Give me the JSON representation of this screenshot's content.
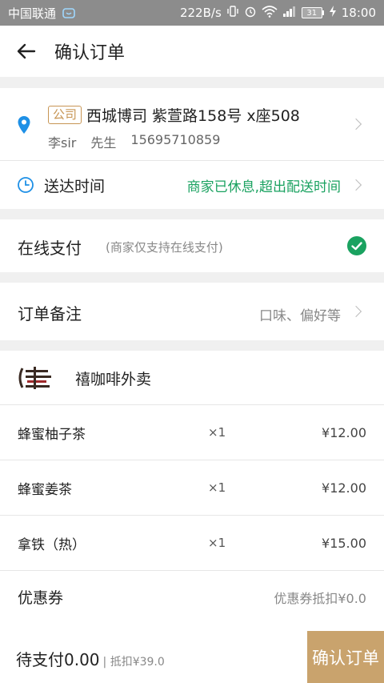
{
  "status_bar": {
    "carrier": "中国联通",
    "speed": "222B/s",
    "battery": "31",
    "time": "18:00"
  },
  "header": {
    "title": "确认订单"
  },
  "address": {
    "tag": "公司",
    "line": "西城博司 紫萱路158号  x座508",
    "name": "李sir",
    "title": "先生",
    "phone": "15695710859"
  },
  "delivery": {
    "label": "送达时间",
    "status": "商家已休息,超出配送时间"
  },
  "payment": {
    "label": "在线支付",
    "note": "(商家仅支持在线支付)"
  },
  "remark": {
    "label": "订单备注",
    "placeholder": "口味、偏好等"
  },
  "shop": {
    "name": "禧咖啡外卖"
  },
  "items": [
    {
      "name": "蜂蜜柚子茶",
      "qty": "×1",
      "price": "¥12.00"
    },
    {
      "name": "蜂蜜姜茶",
      "qty": "×1",
      "price": "¥12.00"
    },
    {
      "name": "拿铁（热）",
      "qty": "×1",
      "price": "¥15.00"
    }
  ],
  "coupon": {
    "label": "优惠券",
    "value": "优惠券抵扣¥0.0"
  },
  "footer": {
    "pending": "待支付0.00",
    "discount": "| 抵扣¥39.0",
    "confirm": "确认订单"
  },
  "colors": {
    "accent_green": "#1aa260",
    "location_blue": "#1e90e6",
    "button_gold": "#c9a36d",
    "tag_gold": "#c79554"
  }
}
